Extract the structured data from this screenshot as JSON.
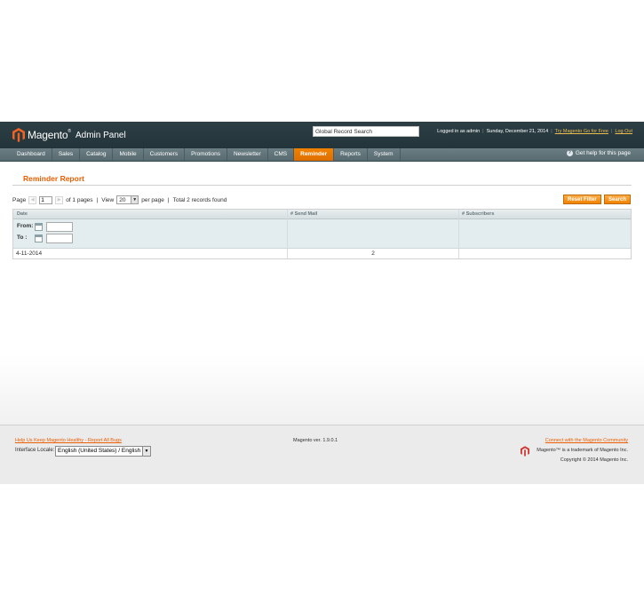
{
  "header": {
    "logo_word": "Magento",
    "logo_trademark": "®",
    "panel_label": "Admin Panel",
    "global_search_value": "Global Record Search",
    "logged_in": "Logged in as admin",
    "date": "Sunday, December 21, 2014",
    "try_go_link": "Try Magento Go for Free",
    "logout_link": "Log Out"
  },
  "nav": {
    "items": [
      "Dashboard",
      "Sales",
      "Catalog",
      "Mobile",
      "Customers",
      "Promotions",
      "Newsletter",
      "CMS",
      "Reminder",
      "Reports",
      "System"
    ],
    "active": "Reminder",
    "help": "Get help for this page"
  },
  "page": {
    "title": "Reminder Report"
  },
  "pager": {
    "page_label": "Page",
    "page_value": "1",
    "of_pages": "of 1 pages",
    "view_label": "View",
    "per_page_value": "20",
    "per_page_label": "per page",
    "total": "Total 2 records found"
  },
  "buttons": {
    "reset": "Reset Filter",
    "search": "Search"
  },
  "grid": {
    "columns": [
      "Date",
      "# Send Mail",
      "# Subscribers"
    ],
    "filter": {
      "from_label": "From:",
      "to_label": "To :"
    },
    "rows": [
      {
        "date": "4-11-2014",
        "send_mail": "2",
        "subscribers": ""
      }
    ]
  },
  "footer": {
    "bug_link": "Help Us Keep Magento Healthy - Report All Bugs",
    "locale_label": "Interface Locale:",
    "locale_value": "English (United States) / English",
    "version": "Magento ver. 1.9.0.1",
    "community_link": "Connect with the Magento Community",
    "trademark": "Magento™ is a trademark of Magento Inc.",
    "copyright": "Copyright © 2014 Magento Inc."
  },
  "colors": {
    "accent": "#eb5e00",
    "header_bg": "#2d3f45",
    "nav_bg": "#5f7379",
    "active_tab": "#f18200"
  },
  "icons": {
    "logo": "magento-logo-icon",
    "help": "help-icon",
    "calendar": "calendar-icon",
    "pager_prev": "arrow-left-icon",
    "pager_next": "arrow-right-icon",
    "dropdown": "chevron-down-icon"
  }
}
